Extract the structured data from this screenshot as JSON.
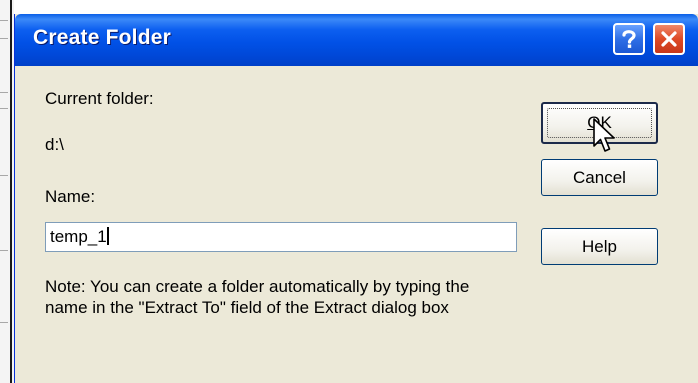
{
  "dialog": {
    "title": "Create Folder",
    "current_folder_label": "Current folder:",
    "current_folder_value": "d:\\",
    "name_label": "Name:",
    "name_value": "temp_1",
    "note": "Note: You can create a folder automatically by typing the name in the \"Extract To\" field of the Extract dialog box"
  },
  "buttons": {
    "ok_first": "O",
    "ok_rest": "K",
    "cancel": "Cancel",
    "help": "Help"
  },
  "titlebar_buttons": [
    "help",
    "close"
  ],
  "icons": [
    "help-icon",
    "close-icon",
    "mouse-cursor-icon"
  ],
  "colors": {
    "titlebar": "#0151e6",
    "dialog_bg": "#ece9d8",
    "close_button": "#de4a26",
    "help_button": "#2f6fe6"
  }
}
